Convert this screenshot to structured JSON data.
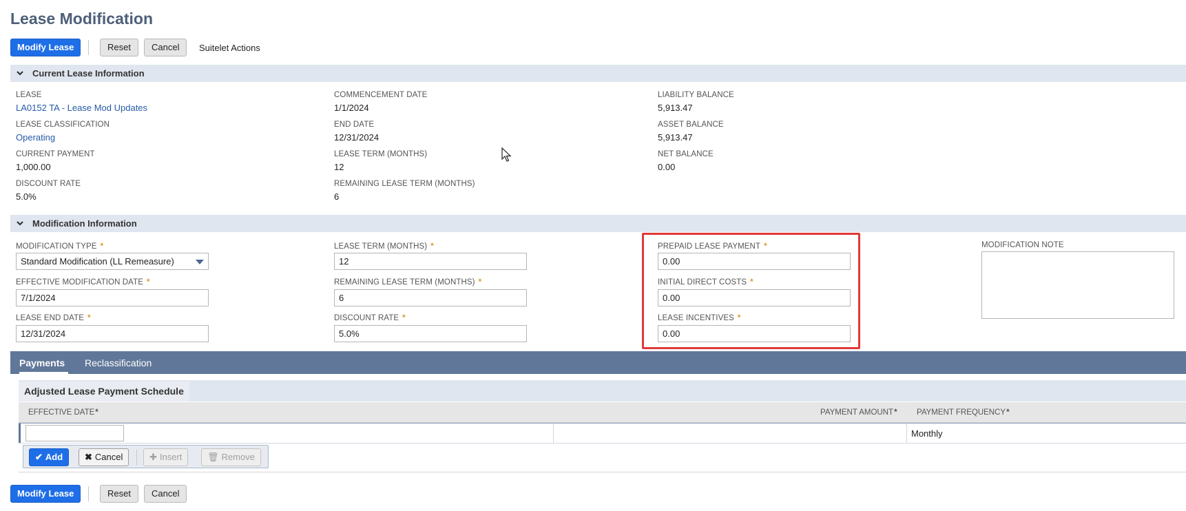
{
  "page": {
    "title": "Lease Modification"
  },
  "toolbar": {
    "modify_label": "Modify Lease",
    "reset_label": "Reset",
    "cancel_label": "Cancel",
    "actions_label": "Suitelet Actions"
  },
  "current_section": {
    "title": "Current Lease Information",
    "lease_label": "LEASE",
    "lease_value": "LA0152 TA - Lease Mod Updates",
    "classification_label": "LEASE CLASSIFICATION",
    "classification_value": "Operating",
    "current_payment_label": "CURRENT PAYMENT",
    "current_payment_value": "1,000.00",
    "discount_rate_label": "DISCOUNT RATE",
    "discount_rate_value": "5.0%",
    "commencement_label": "COMMENCEMENT DATE",
    "commencement_value": "1/1/2024",
    "end_date_label": "END DATE",
    "end_date_value": "12/31/2024",
    "lease_term_label": "LEASE TERM (MONTHS)",
    "lease_term_value": "12",
    "remaining_term_label": "REMAINING LEASE TERM (MONTHS)",
    "remaining_term_value": "6",
    "liability_label": "LIABILITY BALANCE",
    "liability_value": "5,913.47",
    "asset_label": "ASSET BALANCE",
    "asset_value": "5,913.47",
    "net_label": "NET BALANCE",
    "net_value": "0.00"
  },
  "modification_section": {
    "title": "Modification Information",
    "required_mark": "*",
    "mod_type_label": "MODIFICATION TYPE",
    "mod_type_value": "Standard Modification (LL Remeasure)",
    "eff_date_label": "EFFECTIVE MODIFICATION DATE",
    "eff_date_value": "7/1/2024",
    "lease_end_label": "LEASE END DATE",
    "lease_end_value": "12/31/2024",
    "lease_term_label": "LEASE TERM (MONTHS)",
    "lease_term_value": "12",
    "remaining_term_label": "REMAINING LEASE TERM (MONTHS)",
    "remaining_term_value": "6",
    "discount_rate_label": "DISCOUNT RATE",
    "discount_rate_value": "5.0%",
    "prepaid_label": "PREPAID LEASE PAYMENT",
    "prepaid_value": "0.00",
    "idc_label": "INITIAL DIRECT COSTS",
    "idc_value": "0.00",
    "incentives_label": "LEASE INCENTIVES",
    "incentives_value": "0.00",
    "note_label": "MODIFICATION NOTE",
    "note_value": ""
  },
  "tabs": [
    {
      "label": "Payments"
    },
    {
      "label": "Reclassification"
    }
  ],
  "sublist": {
    "title": "Adjusted Lease Payment Schedule",
    "columns": [
      "EFFECTIVE DATE",
      "PAYMENT AMOUNT",
      "PAYMENT FREQUENCY"
    ],
    "required_mark": "*",
    "row": {
      "effective_date": "",
      "payment_amount": "",
      "payment_frequency": "Monthly"
    },
    "buttons": {
      "add": "Add",
      "cancel": "Cancel",
      "insert": "Insert",
      "remove": "Remove"
    }
  },
  "colors": {
    "primary": "#1e6ee7",
    "tabbar": "#607799",
    "section": "#e0e6ef",
    "highlight": "#e0393a",
    "required": "#d99a2b"
  }
}
